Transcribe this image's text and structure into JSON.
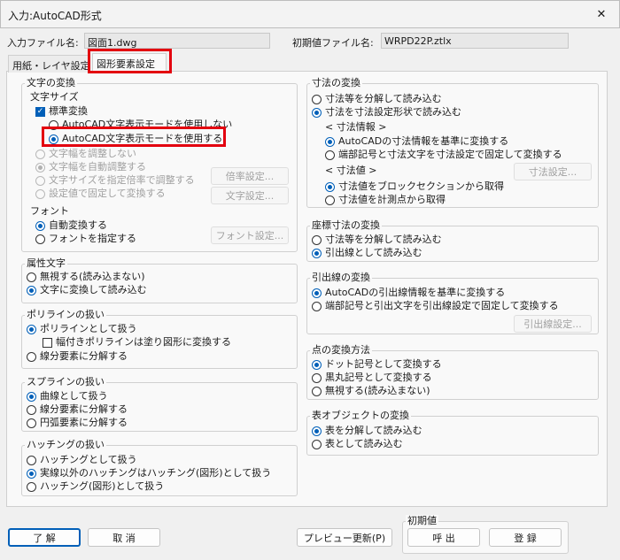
{
  "window": {
    "title": "入力:AutoCAD形式",
    "close_icon": "✕"
  },
  "file": {
    "input_label": "入力ファイル名:",
    "input_value": "図面1.dwg",
    "init_label": "初期値ファイル名:",
    "init_value": "WRPD22P.ztlx"
  },
  "tabs": [
    "用紙・レイヤ設定",
    "図形要素設定"
  ],
  "text_conv": {
    "title": "文字の変換",
    "size_label": "文字サイズ",
    "standard": "標準変換",
    "mode_off": "AutoCAD文字表示モードを使用しない",
    "mode_on": "AutoCAD文字表示モードを使用する",
    "no_adjust": "文字幅を調整しない",
    "auto_adjust": "文字幅を自動調整する",
    "scale_adjust": "文字サイズを指定倍率で調整する",
    "fixed": "設定値で固定して変換する",
    "ratio_btn": "倍率設定...",
    "char_btn": "文字設定...",
    "font_label": "フォント",
    "font_auto": "自動変換する",
    "font_specify": "フォントを指定する",
    "font_btn": "フォント設定..."
  },
  "attr": {
    "title": "属性文字",
    "ignore": "無視する(読み込まない)",
    "to_text": "文字に変換して読み込む"
  },
  "polyline": {
    "title": "ポリラインの扱い",
    "as_poly": "ポリラインとして扱う",
    "width_fill": "幅付きポリラインは塗り図形に変換する",
    "split": "線分要素に分解する"
  },
  "spline": {
    "title": "スプラインの扱い",
    "curve": "曲線として扱う",
    "line": "線分要素に分解する",
    "arc": "円弧要素に分解する"
  },
  "hatch": {
    "title": "ハッチングの扱い",
    "hatch": "ハッチングとして扱う",
    "solid": "実線以外のハッチングはハッチング(図形)として扱う",
    "shape": "ハッチング(図形)として扱う"
  },
  "dim": {
    "title": "寸法の変換",
    "explode": "寸法等を分解して読み込む",
    "as_dim": "寸法を寸法設定形状で読み込む",
    "info_label": "< 寸法情報 >",
    "acad_info": "AutoCADの寸法情報を基準に変換する",
    "fixed_info": "端部記号と寸法文字を寸法設定で固定して変換する",
    "value_label": "< 寸法値 >",
    "dim_btn": "寸法設定...",
    "block": "寸法値をブロックセクションから取得",
    "measure": "寸法値を計測点から取得"
  },
  "coord": {
    "title": "座標寸法の変換",
    "explode": "寸法等を分解して読み込む",
    "leader": "引出線として読み込む"
  },
  "leader": {
    "title": "引出線の変換",
    "acad": "AutoCADの引出線情報を基準に変換する",
    "fixed": "端部記号と引出文字を引出線設定で固定して変換する",
    "btn": "引出線設定..."
  },
  "point": {
    "title": "点の変換方法",
    "dot": "ドット記号として変換する",
    "black": "黒丸記号として変換する",
    "ignore": "無視する(読み込まない)"
  },
  "table": {
    "title": "表オブジェクトの変換",
    "explode": "表を分解して読み込む",
    "as_table": "表として読み込む"
  },
  "footer": {
    "ok": "了 解",
    "cancel": "取 消",
    "preview": "プレビュー更新(P)",
    "init_title": "初期値",
    "call": "呼 出",
    "register": "登 録"
  }
}
